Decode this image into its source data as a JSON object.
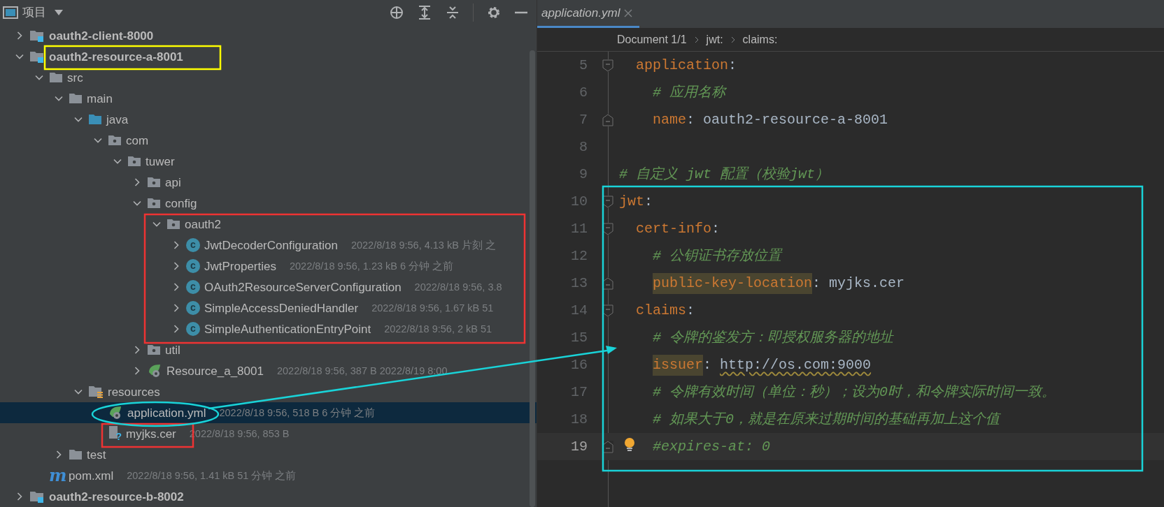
{
  "project_panel": {
    "title": "项目",
    "tree": [
      {
        "name": "oauth2-client-8000",
        "kind": "module",
        "bold": true,
        "expanded": false,
        "selected": false
      },
      {
        "name": "oauth2-resource-a-8001",
        "kind": "module",
        "bold": true,
        "expanded": true,
        "selected": false,
        "children": [
          {
            "name": "src",
            "kind": "folder",
            "expanded": true,
            "selected": false,
            "children": [
              {
                "name": "main",
                "kind": "folder",
                "expanded": true,
                "selected": false,
                "children": [
                  {
                    "name": "java",
                    "kind": "source",
                    "expanded": true,
                    "selected": false,
                    "children": [
                      {
                        "name": "com",
                        "kind": "package",
                        "expanded": true,
                        "selected": false,
                        "children": [
                          {
                            "name": "tuwer",
                            "kind": "package",
                            "expanded": true,
                            "selected": false,
                            "children": [
                              {
                                "name": "api",
                                "kind": "package",
                                "expanded": false,
                                "selected": false
                              },
                              {
                                "name": "config",
                                "kind": "package",
                                "expanded": true,
                                "selected": false,
                                "children": [
                                  {
                                    "name": "oauth2",
                                    "kind": "package",
                                    "expanded": true,
                                    "selected": false,
                                    "children": [
                                      {
                                        "name": "JwtDecoderConfiguration",
                                        "kind": "class",
                                        "glyph": "c",
                                        "meta": "2022/8/18 9:56, 4.13 kB 片刻 之",
                                        "expanded": false,
                                        "selected": false
                                      },
                                      {
                                        "name": "JwtProperties",
                                        "kind": "class",
                                        "glyph": "c",
                                        "meta": "2022/8/18 9:56, 1.23 kB 6 分钟 之前",
                                        "expanded": false,
                                        "selected": false
                                      },
                                      {
                                        "name": "OAuth2ResourceServerConfiguration",
                                        "kind": "class",
                                        "glyph": "c",
                                        "meta": "2022/8/18 9:56, 3.8",
                                        "expanded": false,
                                        "selected": false
                                      },
                                      {
                                        "name": "SimpleAccessDeniedHandler",
                                        "kind": "class",
                                        "glyph": "c",
                                        "meta": "2022/8/18 9:56, 1.67 kB 51",
                                        "expanded": false,
                                        "selected": false
                                      },
                                      {
                                        "name": "SimpleAuthenticationEntryPoint",
                                        "kind": "class",
                                        "glyph": "c",
                                        "meta": "2022/8/18 9:56, 2 kB 51",
                                        "expanded": false,
                                        "selected": false
                                      }
                                    ]
                                  }
                                ]
                              },
                              {
                                "name": "util",
                                "kind": "package",
                                "expanded": false,
                                "selected": false
                              },
                              {
                                "name": "Resource_a_8001",
                                "kind": "spring",
                                "meta": "2022/8/18 9:56, 387 B 2022/8/19 8:00",
                                "expanded": false,
                                "selected": false
                              }
                            ]
                          }
                        ]
                      }
                    ]
                  },
                  {
                    "name": "resources",
                    "kind": "resources",
                    "expanded": true,
                    "selected": false,
                    "children": [
                      {
                        "name": "application.yml",
                        "kind": "spring",
                        "meta": "2022/8/18 9:56, 518 B 6 分钟 之前",
                        "selected": true
                      },
                      {
                        "name": "myjks.cer",
                        "kind": "unknown",
                        "glyph": "?",
                        "meta": "2022/8/18 9:56, 853 B",
                        "selected": false
                      }
                    ]
                  }
                ]
              },
              {
                "name": "test",
                "kind": "folder",
                "expanded": false,
                "selected": false
              }
            ]
          },
          {
            "name": "pom.xml",
            "kind": "maven",
            "glyph": "m",
            "meta": "2022/8/18 9:56, 1.41 kB 51 分钟 之前",
            "selected": false
          }
        ]
      },
      {
        "name": "oauth2-resource-b-8002",
        "kind": "module",
        "bold": true,
        "expanded": false,
        "selected": false
      }
    ]
  },
  "editor": {
    "tab": {
      "title": "application.yml",
      "selected": true
    },
    "breadcrumbs": [
      "Document 1/1",
      "jwt:",
      "claims:"
    ],
    "lines": [
      {
        "number": "5",
        "fold_open": true,
        "current": false,
        "segments": [
          {
            "kind": "key",
            "text": "  application"
          },
          {
            "kind": "plain",
            "text": ":"
          }
        ]
      },
      {
        "number": "6",
        "current": false,
        "segments": [
          {
            "kind": "comment",
            "text": "    # 应用名称"
          }
        ]
      },
      {
        "number": "7",
        "fold_close": true,
        "current": false,
        "segments": [
          {
            "kind": "key",
            "text": "    name"
          },
          {
            "kind": "plain",
            "text": ": oauth2-resource-a-8001"
          }
        ]
      },
      {
        "number": "8",
        "current": false
      },
      {
        "number": "9",
        "current": false,
        "segments": [
          {
            "kind": "comment",
            "text": "# 自定义 jwt 配置（校验jwt）"
          }
        ]
      },
      {
        "number": "10",
        "fold_open": true,
        "current": false,
        "segments": [
          {
            "kind": "key",
            "text": "jwt"
          },
          {
            "kind": "plain",
            "text": ":"
          }
        ]
      },
      {
        "number": "11",
        "fold_open": true,
        "current": false,
        "segments": [
          {
            "kind": "key",
            "text": "  cert-info"
          },
          {
            "kind": "plain",
            "text": ":"
          }
        ]
      },
      {
        "number": "12",
        "current": false,
        "segments": [
          {
            "kind": "comment",
            "text": "    # 公钥证书存放位置"
          }
        ]
      },
      {
        "number": "13",
        "fold_close": true,
        "current": false,
        "segments": [
          {
            "kind": "key",
            "text": "    public-key-location",
            "highlighted": true
          },
          {
            "kind": "plain",
            "text": ": myjks.cer"
          }
        ]
      },
      {
        "number": "14",
        "fold_open": true,
        "current": false,
        "segments": [
          {
            "kind": "key",
            "text": "  claims"
          },
          {
            "kind": "plain",
            "text": ":"
          }
        ]
      },
      {
        "number": "15",
        "current": false,
        "segments": [
          {
            "kind": "comment",
            "text": "    # 令牌的鉴发方：即授权服务器的地址"
          }
        ]
      },
      {
        "number": "16",
        "current": false,
        "segments": [
          {
            "kind": "key",
            "text": "    issuer",
            "highlighted": true
          },
          {
            "kind": "plain",
            "text": ": "
          },
          {
            "kind": "url",
            "text": "http://os.com:9000"
          }
        ]
      },
      {
        "number": "17",
        "current": false,
        "segments": [
          {
            "kind": "comment",
            "text": "    # 令牌有效时间（单位：秒）；设为0时，和令牌实际时间一致。"
          }
        ]
      },
      {
        "number": "18",
        "current": false,
        "segments": [
          {
            "kind": "comment",
            "text": "    # 如果大于0，就是在原来过期时间的基础再加上这个值"
          }
        ]
      },
      {
        "number": "19",
        "fold_close": true,
        "current": true,
        "bulb": true,
        "segments": [
          {
            "kind": "comment",
            "text": "    #expires-at: 0"
          }
        ]
      }
    ]
  }
}
